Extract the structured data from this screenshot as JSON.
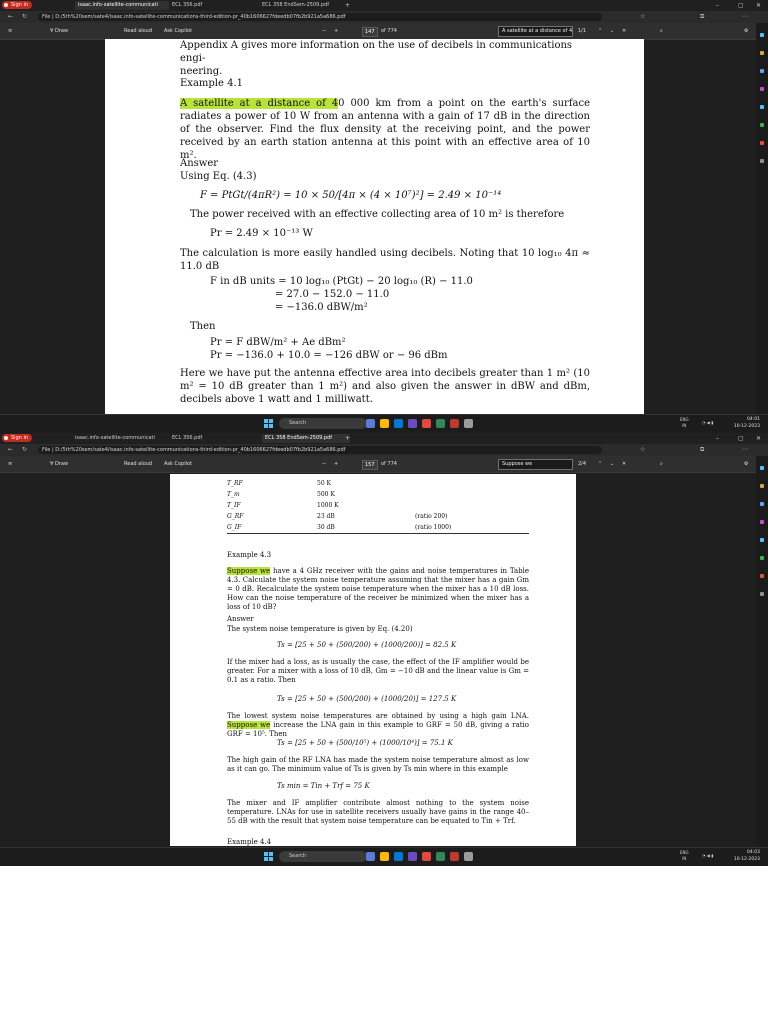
{
  "shot1": {
    "tabs": [
      "isaac.info-satellite-communicati",
      "ECL 356.pdf",
      "ECL 358 EndSem-2509.pdf"
    ],
    "signin": "Sign in",
    "address": "File | D:/5th%20sem/sate4/isaac.info-satellite-communications-third-edition-pr_40b1606627fdeedb07fb2b921a5a686.pdf",
    "toolbar": {
      "draw": "Draw",
      "read_aloud": "Read aloud",
      "ask_copilot": "Ask Copilot",
      "page_num": "147",
      "page_of": "of 774"
    },
    "find": {
      "text": "A satellite at a distance of 4",
      "count": "1/1"
    },
    "page": {
      "line_top": "Appendix A gives more information on the use of decibels in communications engi-",
      "line_top2": "neering.",
      "example_title": "Example 4.1",
      "problem_hl": "A satellite at a distance of 4",
      "problem_rest": "0 000 km from a point on the earth's surface radiates a power of 10 W from an antenna with a gain of 17 dB in the direction of the observer. Find the flux density at the receiving point, and the power received by an earth station antenna at this point with an effective area of 10 m².",
      "answer_title": "Answer",
      "using": "Using Eq. (4.3)",
      "eq1": "F = PtGt/(4πR²) = 10 × 50/[4π × (4 × 10⁷)²] = 2.49 × 10⁻¹⁴",
      "power_text": "The power received with an effective collecting area of 10 m² is therefore",
      "eq2": "Pr = 2.49 × 10⁻¹³ W",
      "calc_text": "The calculation is more easily handled using decibels. Noting that 10 log₁₀ 4π ≈ 11.0 dB",
      "db1": "F in dB units = 10 log₁₀ (PtGt) − 20 log₁₀ (R) − 11.0",
      "db2": "= 27.0 − 152.0 − 11.0",
      "db3": "= −136.0 dBW/m²",
      "then": "Then",
      "eq3": "Pr = F dBW/m² + Ae dBm²",
      "eq4": "Pr = −136.0 + 10.0 = −126 dBW or − 96 dBm",
      "closing": "Here we have put the antenna effective area into decibels greater than 1 m² (10 m² = 10 dB greater than 1 m²) and also given the answer in dBW and dBm, decibels above 1 watt and 1 milliwatt."
    },
    "taskbar": {
      "search": "Search",
      "lang": "ENG",
      "lang2": "IN",
      "time": "04:01",
      "date": "10-12-2023"
    }
  },
  "shot2": {
    "tabs": [
      "isaac.info-satellite-communicati",
      "ECL 356.pdf",
      "ECL 358 EndSem-2509.pdf"
    ],
    "signin": "Sign in",
    "address": "File | D:/5th%20sem/sate4/isaac.info-satellite-communications-third-edition-pr_40b1606627fdeedb07fb2b921a5a686.pdf",
    "toolbar": {
      "draw": "Draw",
      "read_aloud": "Read aloud",
      "ask_copilot": "Ask Copilot",
      "page_num": "157",
      "page_of": "of 774"
    },
    "find": {
      "text": "Suppose we",
      "count": "2/4"
    },
    "table": [
      {
        "label": "T_RF",
        "value": "50 K",
        "ratio": ""
      },
      {
        "label": "T_m",
        "value": "500 K",
        "ratio": ""
      },
      {
        "label": "T_IF",
        "value": "1000 K",
        "ratio": ""
      },
      {
        "label": "G_RF",
        "value": "23 dB",
        "ratio": "(ratio 200)"
      },
      {
        "label": "G_IF",
        "value": "30 dB",
        "ratio": "(ratio 1000)"
      }
    ],
    "page": {
      "example_title": "Example 4.3",
      "problem_hl": "Suppose we",
      "problem_rest": " have a 4 GHz receiver with the gains and noise temperatures in Table 4.3. Calculate the system noise temperature assuming that the mixer has a gain Gm = 0 dB. Recalculate the system noise temperature when the mixer has a 10 dB loss. How can the noise temperature of the receiver be minimized when the mixer has a loss of 10 dB?",
      "answer_title": "Answer",
      "eq_intro": "The system noise temperature is given by Eq. (4.20)",
      "eq1": "Ts = [25 + 50 + (500/200) + (1000/200)] = 82.5 K",
      "loss_text": "If the mixer had a loss, as is usually the case, the effect of the IF amplifier would be greater. For a mixer with a loss of 10 dB, Gm = −10 dB and the linear value is Gm = 0.1 as a ratio. Then",
      "eq2": "Ts = [25 + 50 + (500/200) + (1000/20)] = 127.5 K",
      "lowest_a": "The lowest system noise temperatures are obtained by using a high gain LNA. ",
      "lowest_hl": "Suppose we",
      "lowest_b": " increase the LNA gain in this example to GRF = 50 dB, giving a ratio GRF = 10⁵. Then",
      "eq3": "Ts = [25 + 50 + (500/10⁵) + (1000/10⁴)] = 75.1 K",
      "high_gain": "The high gain of the RF LNA has made the system noise temperature almost as low as it can go. The minimum value of Ts is given by Ts min where in this example",
      "eq4": "Ts min = Tin + Trf = 75 K",
      "mixer_text": "The mixer and IF amplifier contribute almost nothing to the system noise temperature. LNAs for use in satellite receivers usually have gains in the range 40–55 dB with the result that system noise temperature can be equated to Tin + Trf.",
      "next": "Example 4.4"
    },
    "taskbar": {
      "search": "Search",
      "lang": "ENG",
      "lang2": "IN",
      "time": "04:03",
      "date": "10-12-2023"
    }
  },
  "colors": {
    "highlight": "#b8e33a",
    "chrome": "#1f1f1f",
    "accent": "#4cc2ff"
  }
}
